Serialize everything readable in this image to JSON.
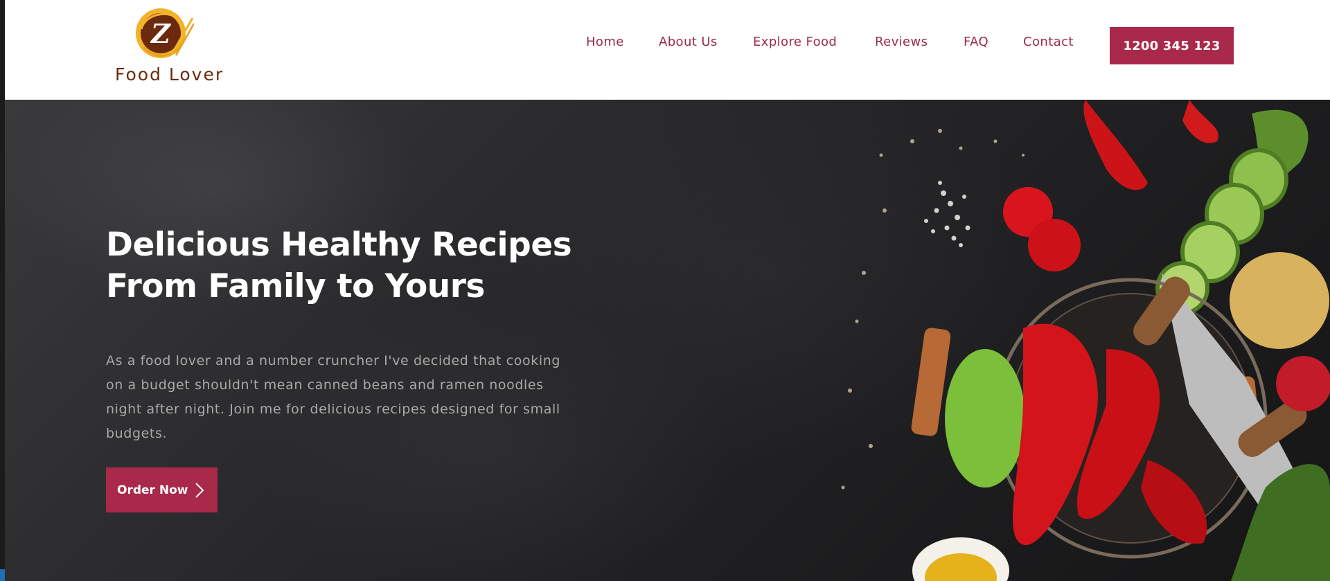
{
  "header": {
    "logo_text": "Food Lover",
    "logo_letter": "Z",
    "nav": [
      {
        "label": "Home"
      },
      {
        "label": "About Us"
      },
      {
        "label": "Explore Food"
      },
      {
        "label": "Reviews"
      },
      {
        "label": "FAQ"
      },
      {
        "label": "Contact"
      }
    ],
    "phone_label": "1200 345 123"
  },
  "hero": {
    "title_line1": "Delicious Healthy Recipes",
    "title_line2": "From Family to Yours",
    "description": "As a food lover and a number cruncher I've decided that cooking on a budget shouldn't mean canned beans and ramen noodles night after night. Join me for delicious recipes designed for small budgets.",
    "cta_label": "Order Now",
    "cta_icon": "chevron-right-icon"
  },
  "colors": {
    "accent": "#a8294a",
    "nav_text": "#9c2a45",
    "logo_brown": "#6a2a0c",
    "hero_bg": "#2a2a2c"
  }
}
